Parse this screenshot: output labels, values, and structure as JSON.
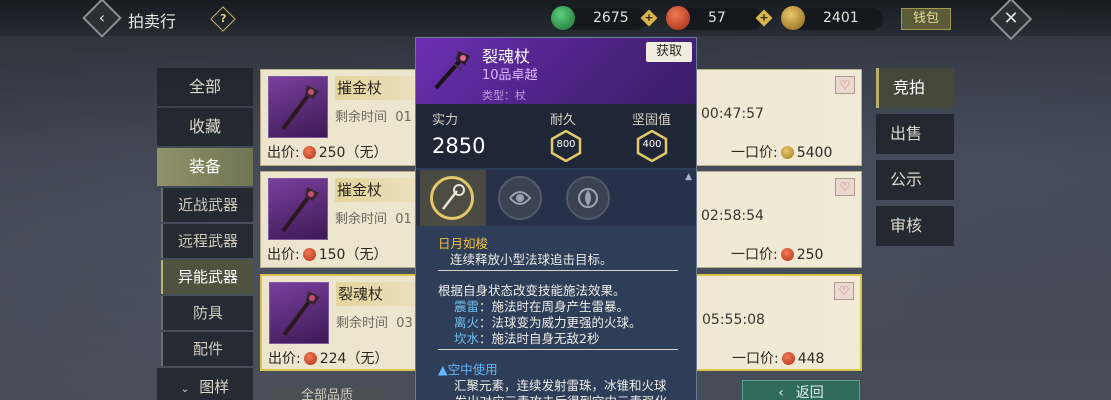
{
  "header": {
    "title": "拍卖行",
    "currencies": [
      {
        "icon": "jade-coin-icon",
        "value": "2675",
        "color": "#2e9c4c"
      },
      {
        "icon": "red-coin-icon",
        "value": "57",
        "color": "#c8402a"
      },
      {
        "icon": "gold-leaf-icon",
        "value": "2401",
        "color": "#b68a2a"
      }
    ],
    "wallet_label": "钱包"
  },
  "sidebar": {
    "items": [
      {
        "label": "全部"
      },
      {
        "label": "收藏"
      },
      {
        "label": "装备"
      }
    ],
    "subitems": [
      {
        "label": "近战武器"
      },
      {
        "label": "远程武器"
      },
      {
        "label": "异能武器"
      },
      {
        "label": "防具"
      },
      {
        "label": "配件"
      }
    ],
    "last_item": "图样"
  },
  "listings": [
    {
      "name": "摧金杖",
      "time_label": "剩余时间",
      "time_frag": "01",
      "time_value": "00:47:57",
      "bid_label": "出价:",
      "bid": "250（无）",
      "buy_label": "一口价:",
      "buy": "5400",
      "buy_coin": "gold"
    },
    {
      "name": "摧金杖",
      "time_label": "剩余时间",
      "time_frag": "01",
      "time_value": "02:58:54",
      "bid_label": "出价:",
      "bid": "150（无）",
      "buy_label": "一口价:",
      "buy": "250",
      "buy_coin": "red"
    },
    {
      "name": "裂魂杖",
      "time_label": "剩余时间",
      "time_frag": "03",
      "time_value": "05:55:08",
      "bid_label": "出价:",
      "bid": "224（无）",
      "buy_label": "一口价:",
      "buy": "448",
      "buy_coin": "red"
    }
  ],
  "right_tabs": [
    {
      "label": "竞拍"
    },
    {
      "label": "出售"
    },
    {
      "label": "公示"
    },
    {
      "label": "审核"
    }
  ],
  "bottom": {
    "filter_label": "全部品质",
    "return_label": "返回"
  },
  "tooltip": {
    "name": "裂魂杖",
    "grade": "10品卓越",
    "type": "类型：杖",
    "obtain_label": "获取",
    "stats": {
      "power_label": "实力",
      "power_value": "2850",
      "durability_label": "耐久",
      "durability_value": "800",
      "solidity_label": "坚固值",
      "solidity_value": "400"
    },
    "skill_title": "日月如梭",
    "skill_desc": "连续释放小型法球追击目标。",
    "effect_intro": "根据自身状态改变技能施法效果。",
    "effects": [
      {
        "key": "震雷",
        "text": "：施法时在周身产生雷暴。"
      },
      {
        "key": "离火",
        "text": "：法球变为威力更强的火球。"
      },
      {
        "key": "坎水",
        "text": "：施法时自身无敌2秒"
      }
    ],
    "air_title": "▲空中使用",
    "air_desc_1": "汇聚元素，连续发射雷珠，冰锥和火球",
    "air_desc_2": "，发出对应元素攻击后得到空中元素强化"
  }
}
